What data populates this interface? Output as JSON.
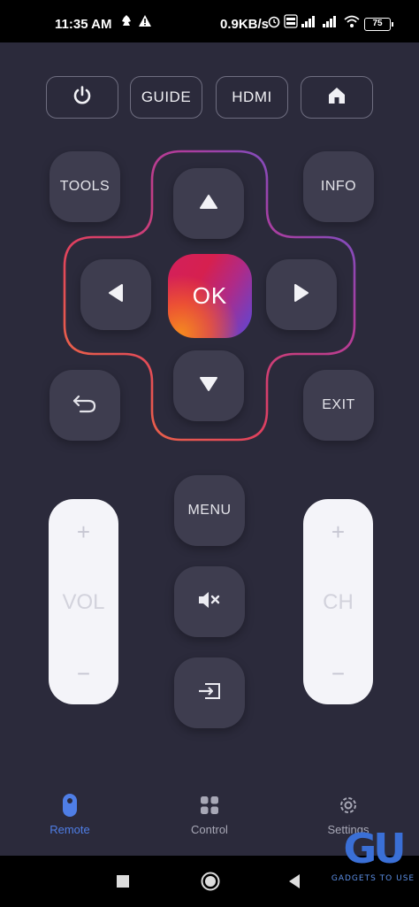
{
  "status_bar": {
    "time": "11:35 AM",
    "speed": "0.9KB/s",
    "battery": "75"
  },
  "top_buttons": {
    "power_icon": "power-icon",
    "guide": "GUIDE",
    "hdmi": "HDMI",
    "home_icon": "home-icon"
  },
  "side_buttons": {
    "tools": "TOOLS",
    "info": "INFO",
    "exit": "EXIT",
    "back_icon": "back-icon"
  },
  "dpad": {
    "ok": "OK"
  },
  "center_column": {
    "menu": "MENU",
    "mute_icon": "mute-icon",
    "input_icon": "input-source-icon"
  },
  "volume": {
    "plus": "+",
    "label": "VOL",
    "minus": "−"
  },
  "channel": {
    "plus": "+",
    "label": "CH",
    "minus": "−"
  },
  "bottom_nav": {
    "items": [
      {
        "label": "Remote",
        "icon": "remote-icon",
        "active": true
      },
      {
        "label": "Control",
        "icon": "grid-icon",
        "active": false
      },
      {
        "label": "Settings",
        "icon": "gear-icon",
        "active": false
      }
    ]
  },
  "watermark": {
    "mark": "GU",
    "text": "GADGETS TO USE"
  },
  "colors": {
    "background": "#2b2a3b",
    "button": "#3e3d4f",
    "accent": "#4f7ee6"
  }
}
